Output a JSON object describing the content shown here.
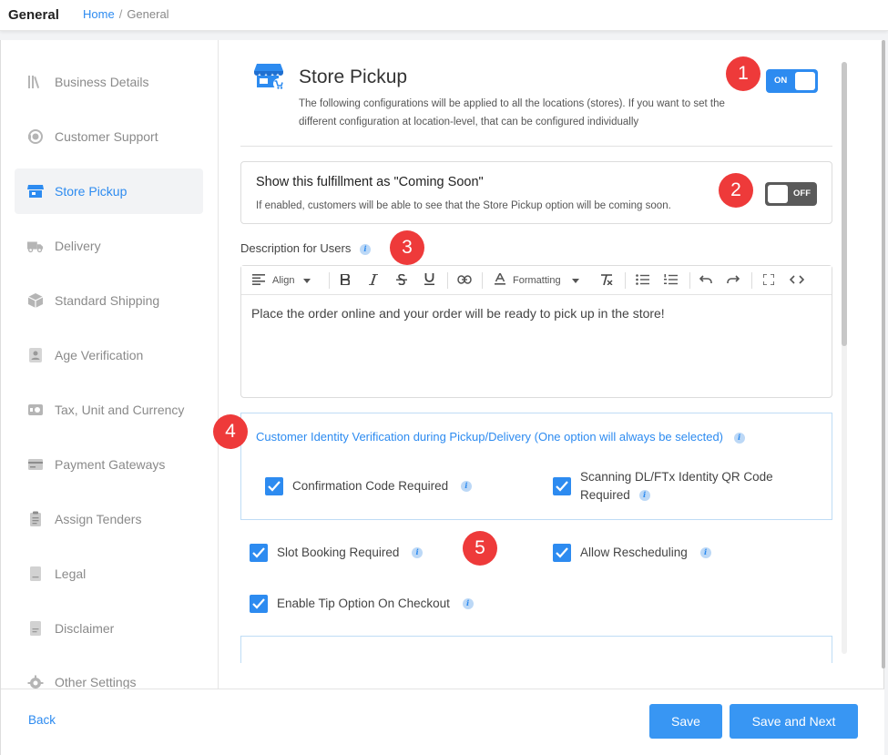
{
  "header": {
    "title": "General",
    "breadcrumb": {
      "home": "Home",
      "separator": "/",
      "current": "General"
    }
  },
  "sidebar": {
    "items": [
      {
        "label": "Business Details",
        "icon": "books-icon"
      },
      {
        "label": "Customer Support",
        "icon": "support-agent-icon"
      },
      {
        "label": "Store Pickup",
        "icon": "store-icon",
        "active": true
      },
      {
        "label": "Delivery",
        "icon": "delivery-truck-icon"
      },
      {
        "label": "Standard Shipping",
        "icon": "package-icon"
      },
      {
        "label": "Age Verification",
        "icon": "id-person-icon"
      },
      {
        "label": "Tax, Unit and Currency",
        "icon": "money-icon"
      },
      {
        "label": "Payment Gateways",
        "icon": "card-icon"
      },
      {
        "label": "Assign Tenders",
        "icon": "clipboard-icon"
      },
      {
        "label": "Legal",
        "icon": "document-icon"
      },
      {
        "label": "Disclaimer",
        "icon": "document-text-icon"
      },
      {
        "label": "Other Settings",
        "icon": "gear-icon"
      }
    ]
  },
  "main": {
    "title": "Store Pickup",
    "description": "The following configurations will be applied to all the locations (stores). If you want to set the different configuration at location-level, that can be configured individually",
    "enabled_toggle": {
      "state": "ON"
    },
    "coming_soon": {
      "title": "Show this fulfillment as \"Coming Soon\"",
      "description": "If enabled, customers will be able to see that the Store Pickup option will be coming soon.",
      "toggle_state": "OFF"
    },
    "description_for_users": {
      "label": "Description for Users",
      "toolbar": {
        "align": "Align",
        "formatting": "Formatting"
      },
      "content": "Place the order online and your order will be ready to pick up in the store!"
    },
    "identity_verification": {
      "title": "Customer Identity Verification during Pickup/Delivery (One option will always be selected)",
      "options": [
        {
          "label": "Confirmation Code Required",
          "checked": true
        },
        {
          "label": "Scanning DL/FTx Identity QR Code Required",
          "checked": true
        }
      ]
    },
    "options": [
      {
        "label": "Slot Booking Required",
        "checked": true
      },
      {
        "label": "Allow Rescheduling",
        "checked": true
      },
      {
        "label": "Enable Tip Option On Checkout",
        "checked": true
      }
    ],
    "markers": [
      "1",
      "2",
      "3",
      "4",
      "5"
    ],
    "info_glyph": "i"
  },
  "footer": {
    "back": "Back",
    "save": "Save",
    "save_next": "Save and Next"
  },
  "colors": {
    "accent": "#2d8bf0",
    "marker": "#ee3a3a",
    "toggle_off": "#5a5a5a"
  }
}
